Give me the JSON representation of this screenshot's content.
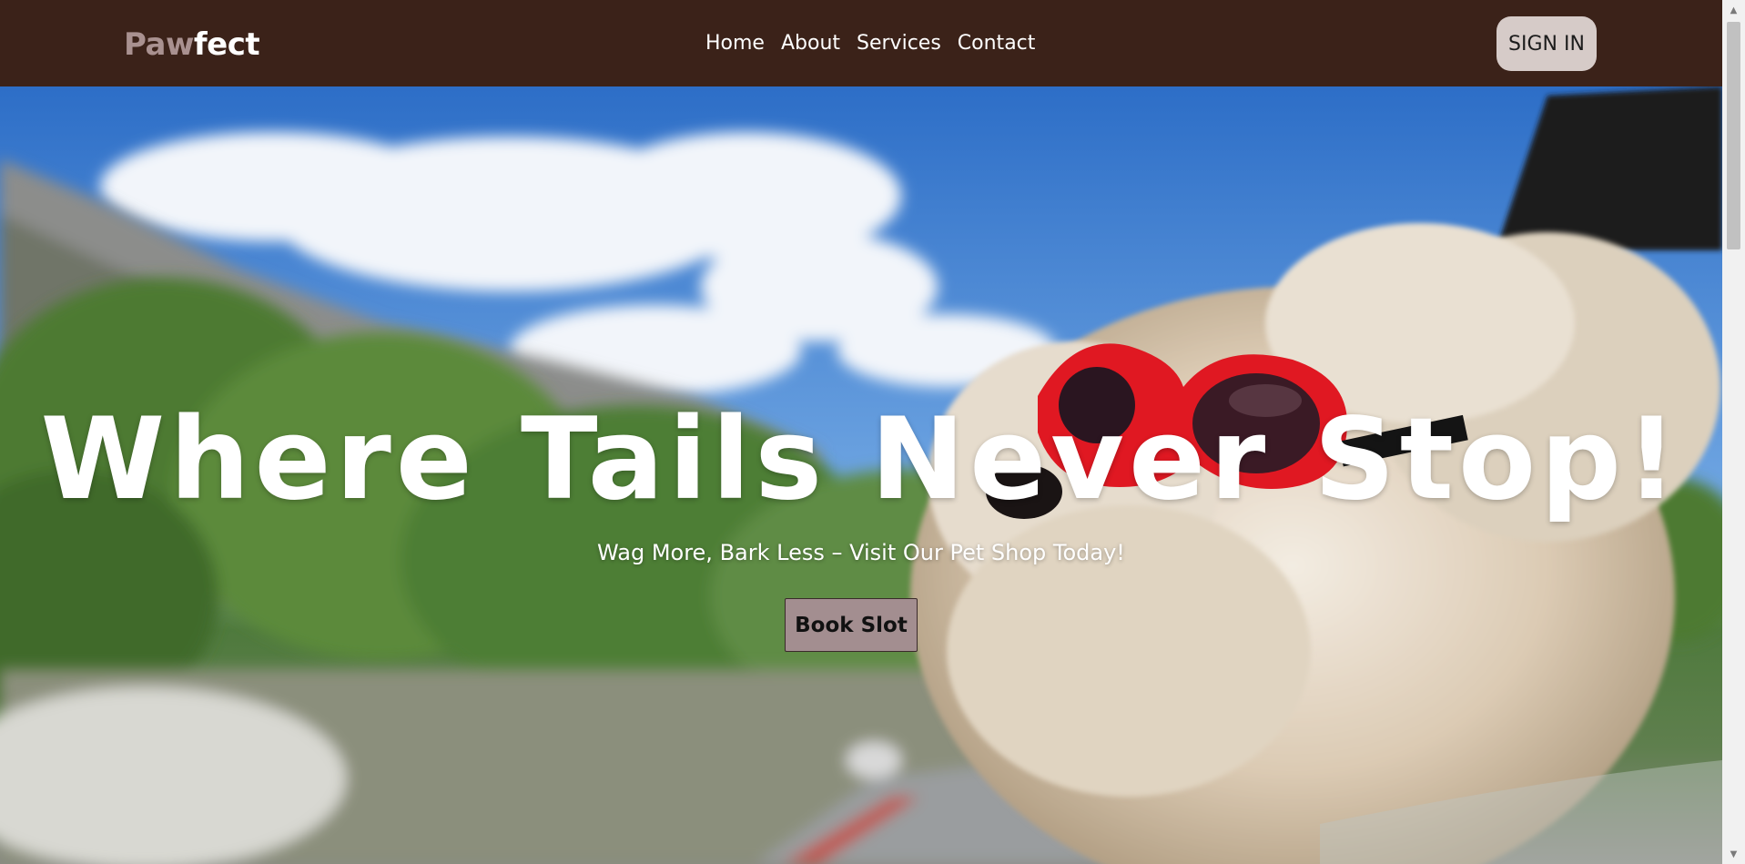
{
  "navbar": {
    "logo_part1": "Paw",
    "logo_part2": "fect",
    "links": [
      "Home",
      "About",
      "Services",
      "Contact"
    ],
    "signin_label": "SIGN IN"
  },
  "hero": {
    "title": "Where Tails Never Stop!",
    "subtitle": "Wag More, Bark Less – Visit Our Pet Shop Today!",
    "cta_label": "Book Slot",
    "image_icon": "dog-with-red-goggles-photo"
  },
  "colors": {
    "nav_background": "#3b2219",
    "logo_accent": "#a99190",
    "signin_background": "#d6cbc8",
    "cta_background": "#a38e90"
  },
  "scrollbar": {
    "up_icon": "chevron-up-icon",
    "down_icon": "chevron-down-icon"
  }
}
